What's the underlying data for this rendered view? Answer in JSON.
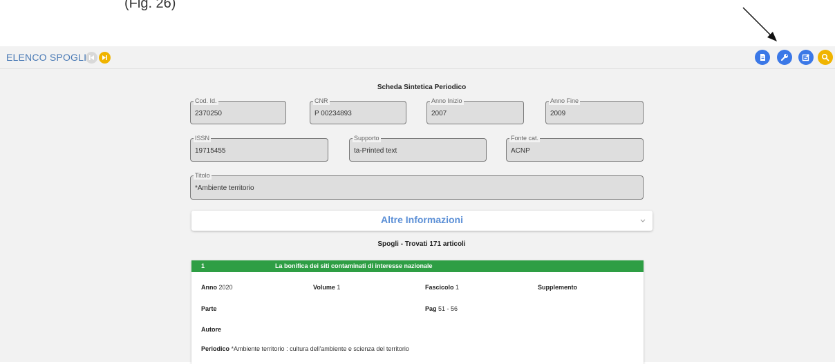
{
  "doc_fragment": "(Fig. 26)",
  "header": {
    "title": "ELENCO SPOGLI",
    "nav": {
      "first_icon": "skip-first-icon",
      "last_icon": "skip-last-icon"
    },
    "toolbar": [
      {
        "icon": "document-icon"
      },
      {
        "icon": "wrench-icon"
      },
      {
        "icon": "edit-note-icon"
      },
      {
        "icon": "search-icon"
      }
    ]
  },
  "scheda": {
    "title": "Scheda Sintetica Periodico",
    "fields": {
      "cod_id": {
        "label": "Cod. Id.",
        "value": "2370250"
      },
      "cnr": {
        "label": "CNR",
        "value": "P 00234893"
      },
      "anno_inizio": {
        "label": "Anno Inizio",
        "value": "2007"
      },
      "anno_fine": {
        "label": "Anno Fine",
        "value": "2009"
      },
      "issn": {
        "label": "ISSN",
        "value": "19715455"
      },
      "supporto": {
        "label": "Supporto",
        "value": "ta-Printed text"
      },
      "fonte_cat": {
        "label": "Fonte cat.",
        "value": "ACNP"
      },
      "titolo": {
        "label": "Titolo",
        "value": "*Ambiente territorio"
      }
    }
  },
  "altre_informazioni": {
    "title": "Altre Informazioni"
  },
  "spogli": {
    "title": "Spogli - Trovati 171 articoli",
    "articles": [
      {
        "number": "1",
        "title": "La bonifica dei siti contaminati di interesse nazionale",
        "anno_label": "Anno",
        "anno": "2020",
        "volume_label": "Volume",
        "volume": "1",
        "fascicolo_label": "Fascicolo",
        "fascicolo": "1",
        "supplemento_label": "Supplemento",
        "parte_label": "Parte",
        "pag_label": "Pag",
        "pag": "51 - 56",
        "autore_label": "Autore",
        "periodico_label": "Periodico",
        "periodico": "*Ambiente territorio : cultura dell'ambiente e scienza del territorio"
      }
    ]
  },
  "colors": {
    "accent_blue": "#3b78e7",
    "accent_yellow": "#f0b400",
    "header_text": "#4a7ab5",
    "card_header_green": "#2e9e44"
  }
}
